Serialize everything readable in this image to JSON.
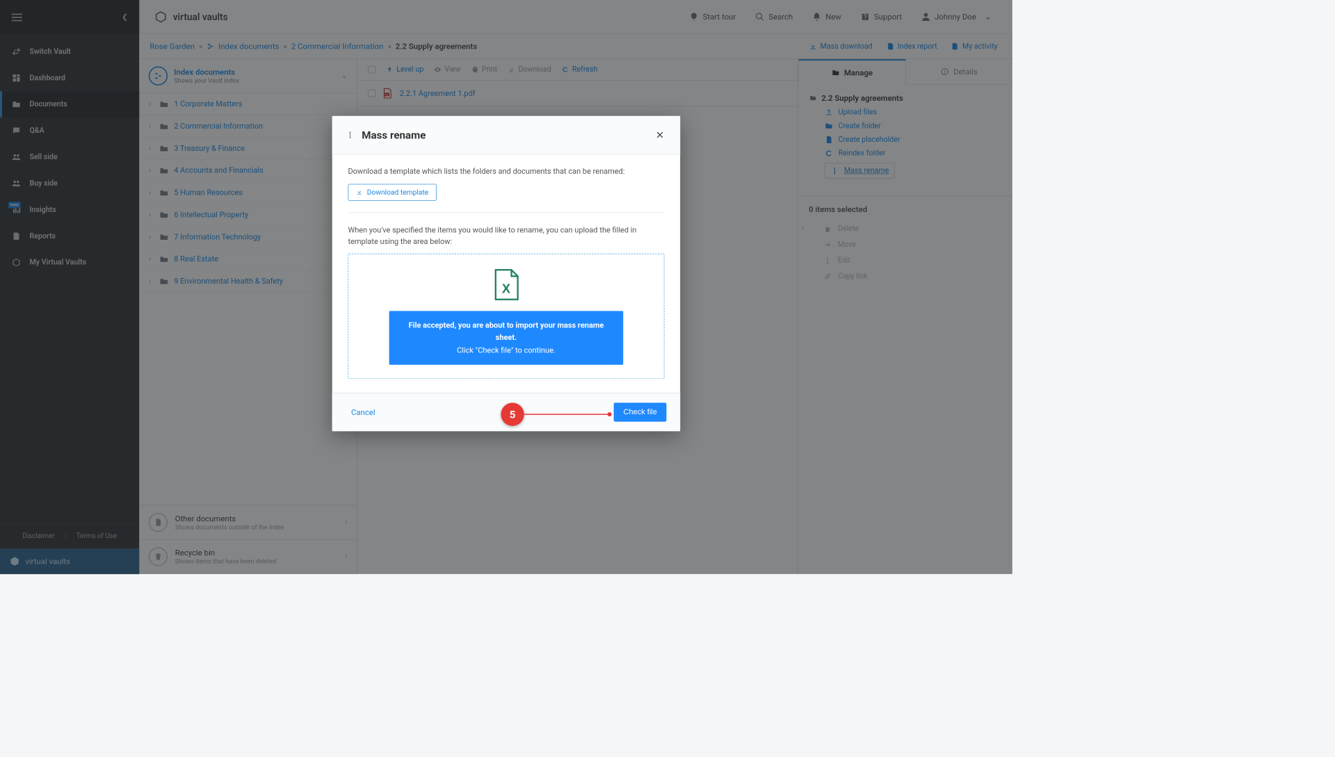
{
  "brand": "virtual vaults",
  "sidebar": {
    "items": [
      {
        "label": "Switch Vault"
      },
      {
        "label": "Dashboard"
      },
      {
        "label": "Documents"
      },
      {
        "label": "Q&A"
      },
      {
        "label": "Sell side"
      },
      {
        "label": "Buy side"
      },
      {
        "label": "Insights",
        "badge": "new"
      },
      {
        "label": "Reports"
      },
      {
        "label": "My Virtual Vaults"
      }
    ],
    "footer": {
      "disclaimer": "Disclaimer",
      "terms": "Terms of Use"
    },
    "brand_footer": "virtual vaults"
  },
  "topnav": {
    "start_tour": "Start tour",
    "search": "Search",
    "new": "New",
    "support": "Support",
    "user": "Johnny Doe"
  },
  "breadcrumb": {
    "root": "Rose Garden",
    "level1": "Index documents",
    "level2": "2 Commercial Information",
    "current": "2.2 Supply agreements",
    "actions": {
      "mass_download": "Mass download",
      "index_report": "Index report",
      "my_activity": "My activity"
    }
  },
  "tree": {
    "header": {
      "title": "Index documents",
      "subtitle": "Shows your Vault index"
    },
    "folders": [
      {
        "label": "1 Corporate Matters"
      },
      {
        "label": "2 Commercial Information"
      },
      {
        "label": "3 Treasury & Finance"
      },
      {
        "label": "4 Accounts and Financials"
      },
      {
        "label": "5 Human Resources"
      },
      {
        "label": "6 Intellectual Property"
      },
      {
        "label": "7 Information Technology"
      },
      {
        "label": "8 Real Estate"
      },
      {
        "label": "9 Environmental Health & Safety"
      }
    ],
    "bottom": [
      {
        "title": "Other documents",
        "subtitle": "Shows documents outside of the index"
      },
      {
        "title": "Recycle bin",
        "subtitle": "Shows items that have been deleted"
      }
    ]
  },
  "filetoolbar": {
    "level_up": "Level up",
    "view": "View",
    "print": "Print",
    "download": "Download",
    "refresh": "Refresh"
  },
  "files": [
    {
      "name": "2.2.1 Agreement 1.pdf"
    }
  ],
  "manage": {
    "tab_manage": "Manage",
    "tab_details": "Details",
    "section_title": "2.2 Supply agreements",
    "links": {
      "upload": "Upload files",
      "create_folder": "Create folder",
      "create_placeholder": "Create placeholder",
      "reindex": "Reindex folder",
      "mass_rename": "Mass rename"
    },
    "selected_count": "0 items selected",
    "actions": {
      "delete": "Delete",
      "move": "Move",
      "edit": "Edit",
      "copy_link": "Copy link"
    }
  },
  "modal": {
    "title": "Mass rename",
    "intro": "Download a template which lists the folders and documents that can be renamed:",
    "download_btn": "Download template",
    "upload_intro": "When you've specified the items you would like to rename, you can upload the filled in template using the area below:",
    "accepted_line1": "File accepted, you are about to import your mass rename sheet.",
    "accepted_line2": "Click \"Check file\" to continue.",
    "cancel": "Cancel",
    "check_file": "Check file",
    "callout_num": "5"
  }
}
